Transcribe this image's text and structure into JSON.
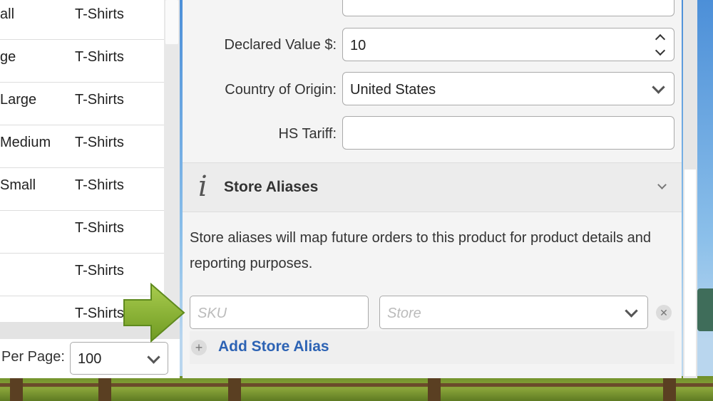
{
  "table": {
    "rows": [
      {
        "name": "all",
        "category": "T-Shirts"
      },
      {
        "name": "ge",
        "category": "T-Shirts"
      },
      {
        "name": "Large",
        "category": "T-Shirts"
      },
      {
        "name": "Medium",
        "category": "T-Shirts"
      },
      {
        "name": "Small",
        "category": "T-Shirts"
      },
      {
        "name": "",
        "category": "T-Shirts"
      },
      {
        "name": "",
        "category": "T-Shirts"
      },
      {
        "name": "",
        "category": "T-Shirts"
      }
    ],
    "per_page_label": "Per Page:",
    "per_page_value": "100"
  },
  "form": {
    "declared_value_label": "Declared Value $:",
    "declared_value": "10",
    "country_label": "Country of Origin:",
    "country_value": "United States",
    "hs_tariff_label": "HS Tariff:",
    "hs_tariff_value": ""
  },
  "store_aliases": {
    "title": "Store Aliases",
    "info_icon": "i",
    "description": "Store aliases will map future orders to this product for product details and reporting purposes.",
    "sku_placeholder": "SKU",
    "store_placeholder": "Store",
    "remove_glyph": "✕",
    "add_glyph": "+",
    "add_label": "Add Store Alias"
  },
  "icons": [
    "info-icon",
    "chevron-down-icon",
    "spinner-up-icon",
    "spinner-down-icon",
    "close-icon",
    "plus-icon",
    "arrow-pointer-icon"
  ],
  "colors": {
    "link": "#2d63b4",
    "arrow": "#8fb63a"
  }
}
